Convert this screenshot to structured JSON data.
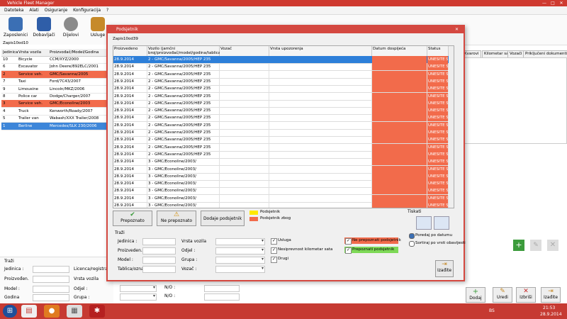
{
  "window": {
    "title": "Vehicle Fleet Manager"
  },
  "menu": [
    "Datoteka",
    "Alati",
    "Osiguranje",
    "Konfiguracija",
    "?"
  ],
  "toolbar": [
    {
      "label": "Zaposlenici",
      "icon": "people-icon",
      "color": "#3b6fb4"
    },
    {
      "label": "Dobavljači",
      "icon": "supplier-icon",
      "color": "#2f5ea8"
    },
    {
      "label": "Dijelovi",
      "icon": "gears-icon",
      "color": "#6a6a6a"
    },
    {
      "label": "Usluge",
      "icon": "tools-icon",
      "color": "#c68a2a"
    }
  ],
  "left_table": {
    "columns": [
      "Jedinica",
      "Vrsta vozila",
      "Proizvođač/Model/Godina"
    ],
    "rows": [
      {
        "id": "10",
        "type": "Bicycle",
        "model": "CCM/XYZ/2000",
        "state": "normal"
      },
      {
        "id": "6",
        "type": "Excavator",
        "model": "John Deere/892ELC/2001",
        "state": "normal"
      },
      {
        "id": "2",
        "type": "Service veh.",
        "model": "GMC/Savanna/2005",
        "state": "red"
      },
      {
        "id": "7",
        "type": "Taxi",
        "model": "Ford/7C43/2007",
        "state": "normal"
      },
      {
        "id": "9",
        "type": "Limousine",
        "model": "Lincoln/MKZ/2006",
        "state": "normal"
      },
      {
        "id": "8",
        "type": "Police car",
        "model": "Dodge/Charger/2007",
        "state": "normal"
      },
      {
        "id": "3",
        "type": "Service veh.",
        "model": "GMC/Econoline/2003",
        "state": "red"
      },
      {
        "id": "4",
        "type": "Truck",
        "model": "Kenworth/Roady/2007",
        "state": "normal"
      },
      {
        "id": "5",
        "type": "Trailer van",
        "model": "Wabash/XXX Trailer/2008",
        "state": "normal"
      },
      {
        "id": "1",
        "type": "Berline",
        "model": "Mercedes/SLK 230/2006",
        "state": "blue"
      }
    ],
    "count": "Zapis10od10"
  },
  "left_search": {
    "title": "Traži",
    "fields": [
      "Jedinica :",
      "Proizvođen.",
      "Model :",
      "Godina"
    ],
    "fields2": [
      "Licenca/registracija",
      "Vrsta vozila",
      "Odjel :",
      "Grupa :"
    ],
    "fields3": [
      "N/O :",
      "N/O :"
    ]
  },
  "right_tabs": [
    "Kvarovi",
    "Kilometar sat",
    "Vozači",
    "Priključeni dokumenti"
  ],
  "dialog": {
    "title": "Podsjetnik",
    "count": "Zapis10od39",
    "columns": [
      "Proizvedeno",
      "Vozilo (jamčni broj/proizvođač/model/godina/tablica)",
      "Vozač",
      "Vrsta upozorenja",
      "Datum dospijeća",
      "Status"
    ],
    "rows": [
      {
        "date": "28.9.2014",
        "vehicle": "2 - GMC/Savanna/2005/HEP 235",
        "status": "UNESITE S..."
      },
      {
        "date": "28.9.2014",
        "vehicle": "2 - GMC/Savanna/2005/HEP 235",
        "status": "UNESITE S..."
      },
      {
        "date": "28.9.2014",
        "vehicle": "2 - GMC/Savanna/2005/HEP 235",
        "status": "UNESITE S..."
      },
      {
        "date": "28.9.2014",
        "vehicle": "2 - GMC/Savanna/2005/HEP 235",
        "status": "UNESITE S..."
      },
      {
        "date": "28.9.2014",
        "vehicle": "2 - GMC/Savanna/2005/HEP 235",
        "status": "UNESITE S..."
      },
      {
        "date": "28.9.2014",
        "vehicle": "2 - GMC/Savanna/2005/HEP 235",
        "status": "UNESITE S..."
      },
      {
        "date": "28.9.2014",
        "vehicle": "2 - GMC/Savanna/2005/HEP 235",
        "status": "UNESITE S..."
      },
      {
        "date": "28.9.2014",
        "vehicle": "2 - GMC/Savanna/2005/HEP 235",
        "status": "UNESITE S..."
      },
      {
        "date": "28.9.2014",
        "vehicle": "2 - GMC/Savanna/2005/HEP 235",
        "status": "UNESITE S..."
      },
      {
        "date": "28.9.2014",
        "vehicle": "2 - GMC/Savanna/2005/HEP 235",
        "status": "UNESITE S..."
      },
      {
        "date": "28.9.2014",
        "vehicle": "2 - GMC/Savanna/2005/HEP 235",
        "status": "UNESITE S..."
      },
      {
        "date": "28.9.2014",
        "vehicle": "2 - GMC/Savanna/2005/HEP 235",
        "status": "UNESITE S..."
      },
      {
        "date": "28.9.2014",
        "vehicle": "2 - GMC/Savanna/2005/HEP 235",
        "status": "UNESITE S..."
      },
      {
        "date": "28.9.2014",
        "vehicle": "2 - GMC/Savanna/2005/HEP 235",
        "status": "UNESITE S..."
      },
      {
        "date": "28.9.2014",
        "vehicle": "3 - GMC/Econoline/2003/",
        "status": "UNESITE S..."
      },
      {
        "date": "28.9.2014",
        "vehicle": "3 - GMC/Econoline/2003/",
        "status": "UNESITE S..."
      },
      {
        "date": "28.9.2014",
        "vehicle": "3 - GMC/Econoline/2003/",
        "status": "UNESITE S..."
      },
      {
        "date": "28.9.2014",
        "vehicle": "3 - GMC/Econoline/2003/",
        "status": "UNESITE S..."
      },
      {
        "date": "28.9.2014",
        "vehicle": "3 - GMC/Econoline/2003/",
        "status": "UNESITE S..."
      },
      {
        "date": "28.9.2014",
        "vehicle": "3 - GMC/Econoline/2003/",
        "status": "UNESITE S..."
      },
      {
        "date": "28.9.2014",
        "vehicle": "3 - GMC/Econoline/2003/",
        "status": "UNESITE S..."
      }
    ],
    "buttons": {
      "recognized": "Prepoznato",
      "not_recognized": "Ne prepoznato",
      "edit": "Dodaje podsjetnik"
    },
    "legend": [
      "Podsjetnik",
      "Podsjetnik zbog"
    ],
    "print_label": "Tiskati",
    "sort": [
      "Poredaj po datumu",
      "Sortiraj po vrsti obavijesti"
    ],
    "search_title": "Traži",
    "search_fields": [
      "Jedinica :",
      "Proizveden.",
      "Model :",
      "Tablica/oznak"
    ],
    "search_fields2": [
      "Vrsta vozila",
      "Odjel :",
      "Grupa :",
      "Vozač :"
    ],
    "checks": [
      "Usluga",
      "Nesiprevnost kilometar sata",
      "Drugi"
    ],
    "checks_right": [
      "Ne prepoznati podsjetnik",
      "Prepoznati podsjetnik"
    ],
    "exit": "Izađite"
  },
  "actions": [
    "Dodaj",
    "Uredi",
    "Izbriši",
    "Izađite"
  ],
  "clock": {
    "time": "21:53",
    "date": "28.9.2014",
    "lang": "BS"
  },
  "colors": {
    "accent": "#d44840",
    "alert": "#f26b4b",
    "selection": "#2d7fd9"
  }
}
